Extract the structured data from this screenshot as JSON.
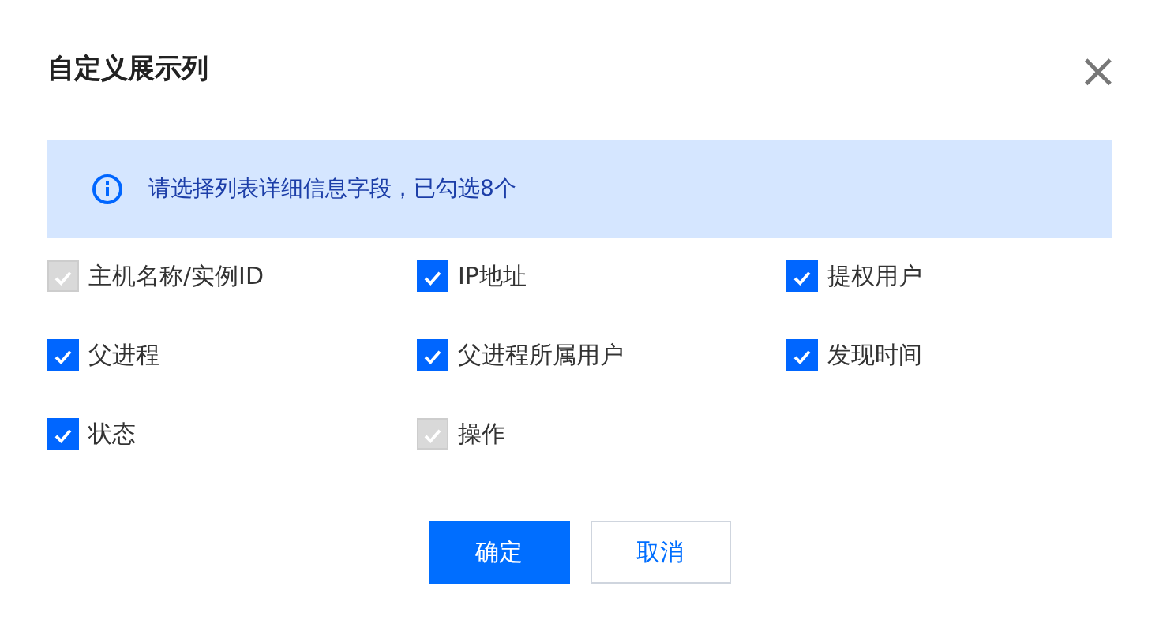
{
  "dialog": {
    "title": "自定义展示列",
    "close": "×"
  },
  "alert": {
    "text": "请选择列表详细信息字段，已勾选8个"
  },
  "options": [
    {
      "label": "主机名称/实例ID",
      "checked": true,
      "disabled": true
    },
    {
      "label": "IP地址",
      "checked": true,
      "disabled": false
    },
    {
      "label": "提权用户",
      "checked": true,
      "disabled": false
    },
    {
      "label": "父进程",
      "checked": true,
      "disabled": false
    },
    {
      "label": "父进程所属用户",
      "checked": true,
      "disabled": false
    },
    {
      "label": "发现时间",
      "checked": true,
      "disabled": false
    },
    {
      "label": "状态",
      "checked": true,
      "disabled": false
    },
    {
      "label": "操作",
      "checked": true,
      "disabled": true
    }
  ],
  "buttons": [
    {
      "label": "确定",
      "kind": "primary"
    },
    {
      "label": "取消",
      "kind": "secondary"
    }
  ]
}
